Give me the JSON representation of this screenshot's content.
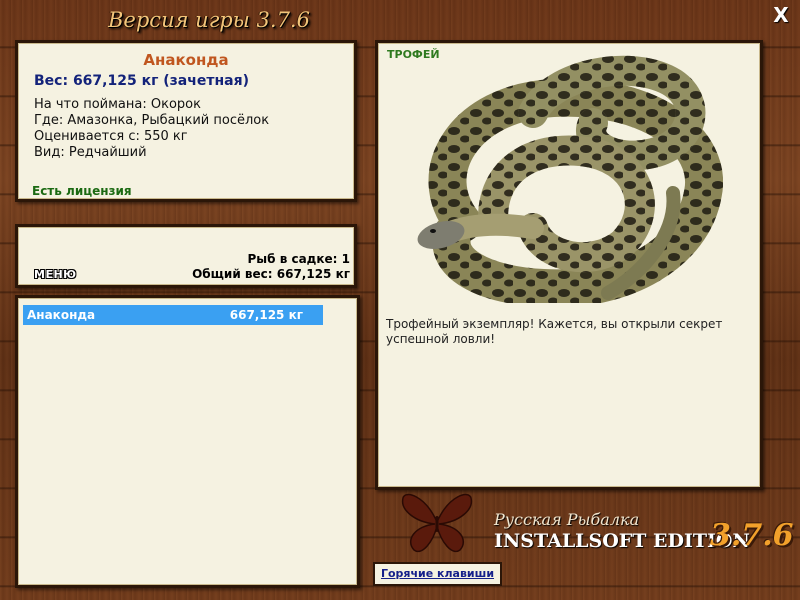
{
  "window": {
    "title": "Версия игры 3.7.6",
    "close_label": "X"
  },
  "fish_info": {
    "name": "Анаконда",
    "weight": "Вес: 667,125 кг (зачетная)",
    "caught_on": "На что поймана: Окорок",
    "location": "Где: Амазонка, Рыбацкий посёлок",
    "valued_from": "Оценивается с: 550 кг",
    "kind": "Вид: Редчайший",
    "license": "Есть лицензия"
  },
  "summary": {
    "menu_label": "МЕНЮ",
    "fish_count": "Рыб в садке: 1",
    "total_weight": "Общий вес: 667,125 кг"
  },
  "catch_list": {
    "items": [
      {
        "name": "Анаконда",
        "weight": "667,125 кг",
        "selected": true
      }
    ]
  },
  "trophy": {
    "label": "ТРОФЕЙ",
    "description": "Трофейный экземпляр! Кажется, вы открыли секрет успешной ловли!"
  },
  "branding": {
    "line1": "Русская Рыбалка",
    "line2": "INSTALLSOFT EDITION",
    "version": "3.7.6"
  },
  "hotkeys_label": "Горячие клавиши",
  "colors": {
    "selection": "#3aa0f2",
    "panel_bg": "#f5f2e1",
    "fish_name": "#c0561f",
    "license": "#1b6a12"
  }
}
